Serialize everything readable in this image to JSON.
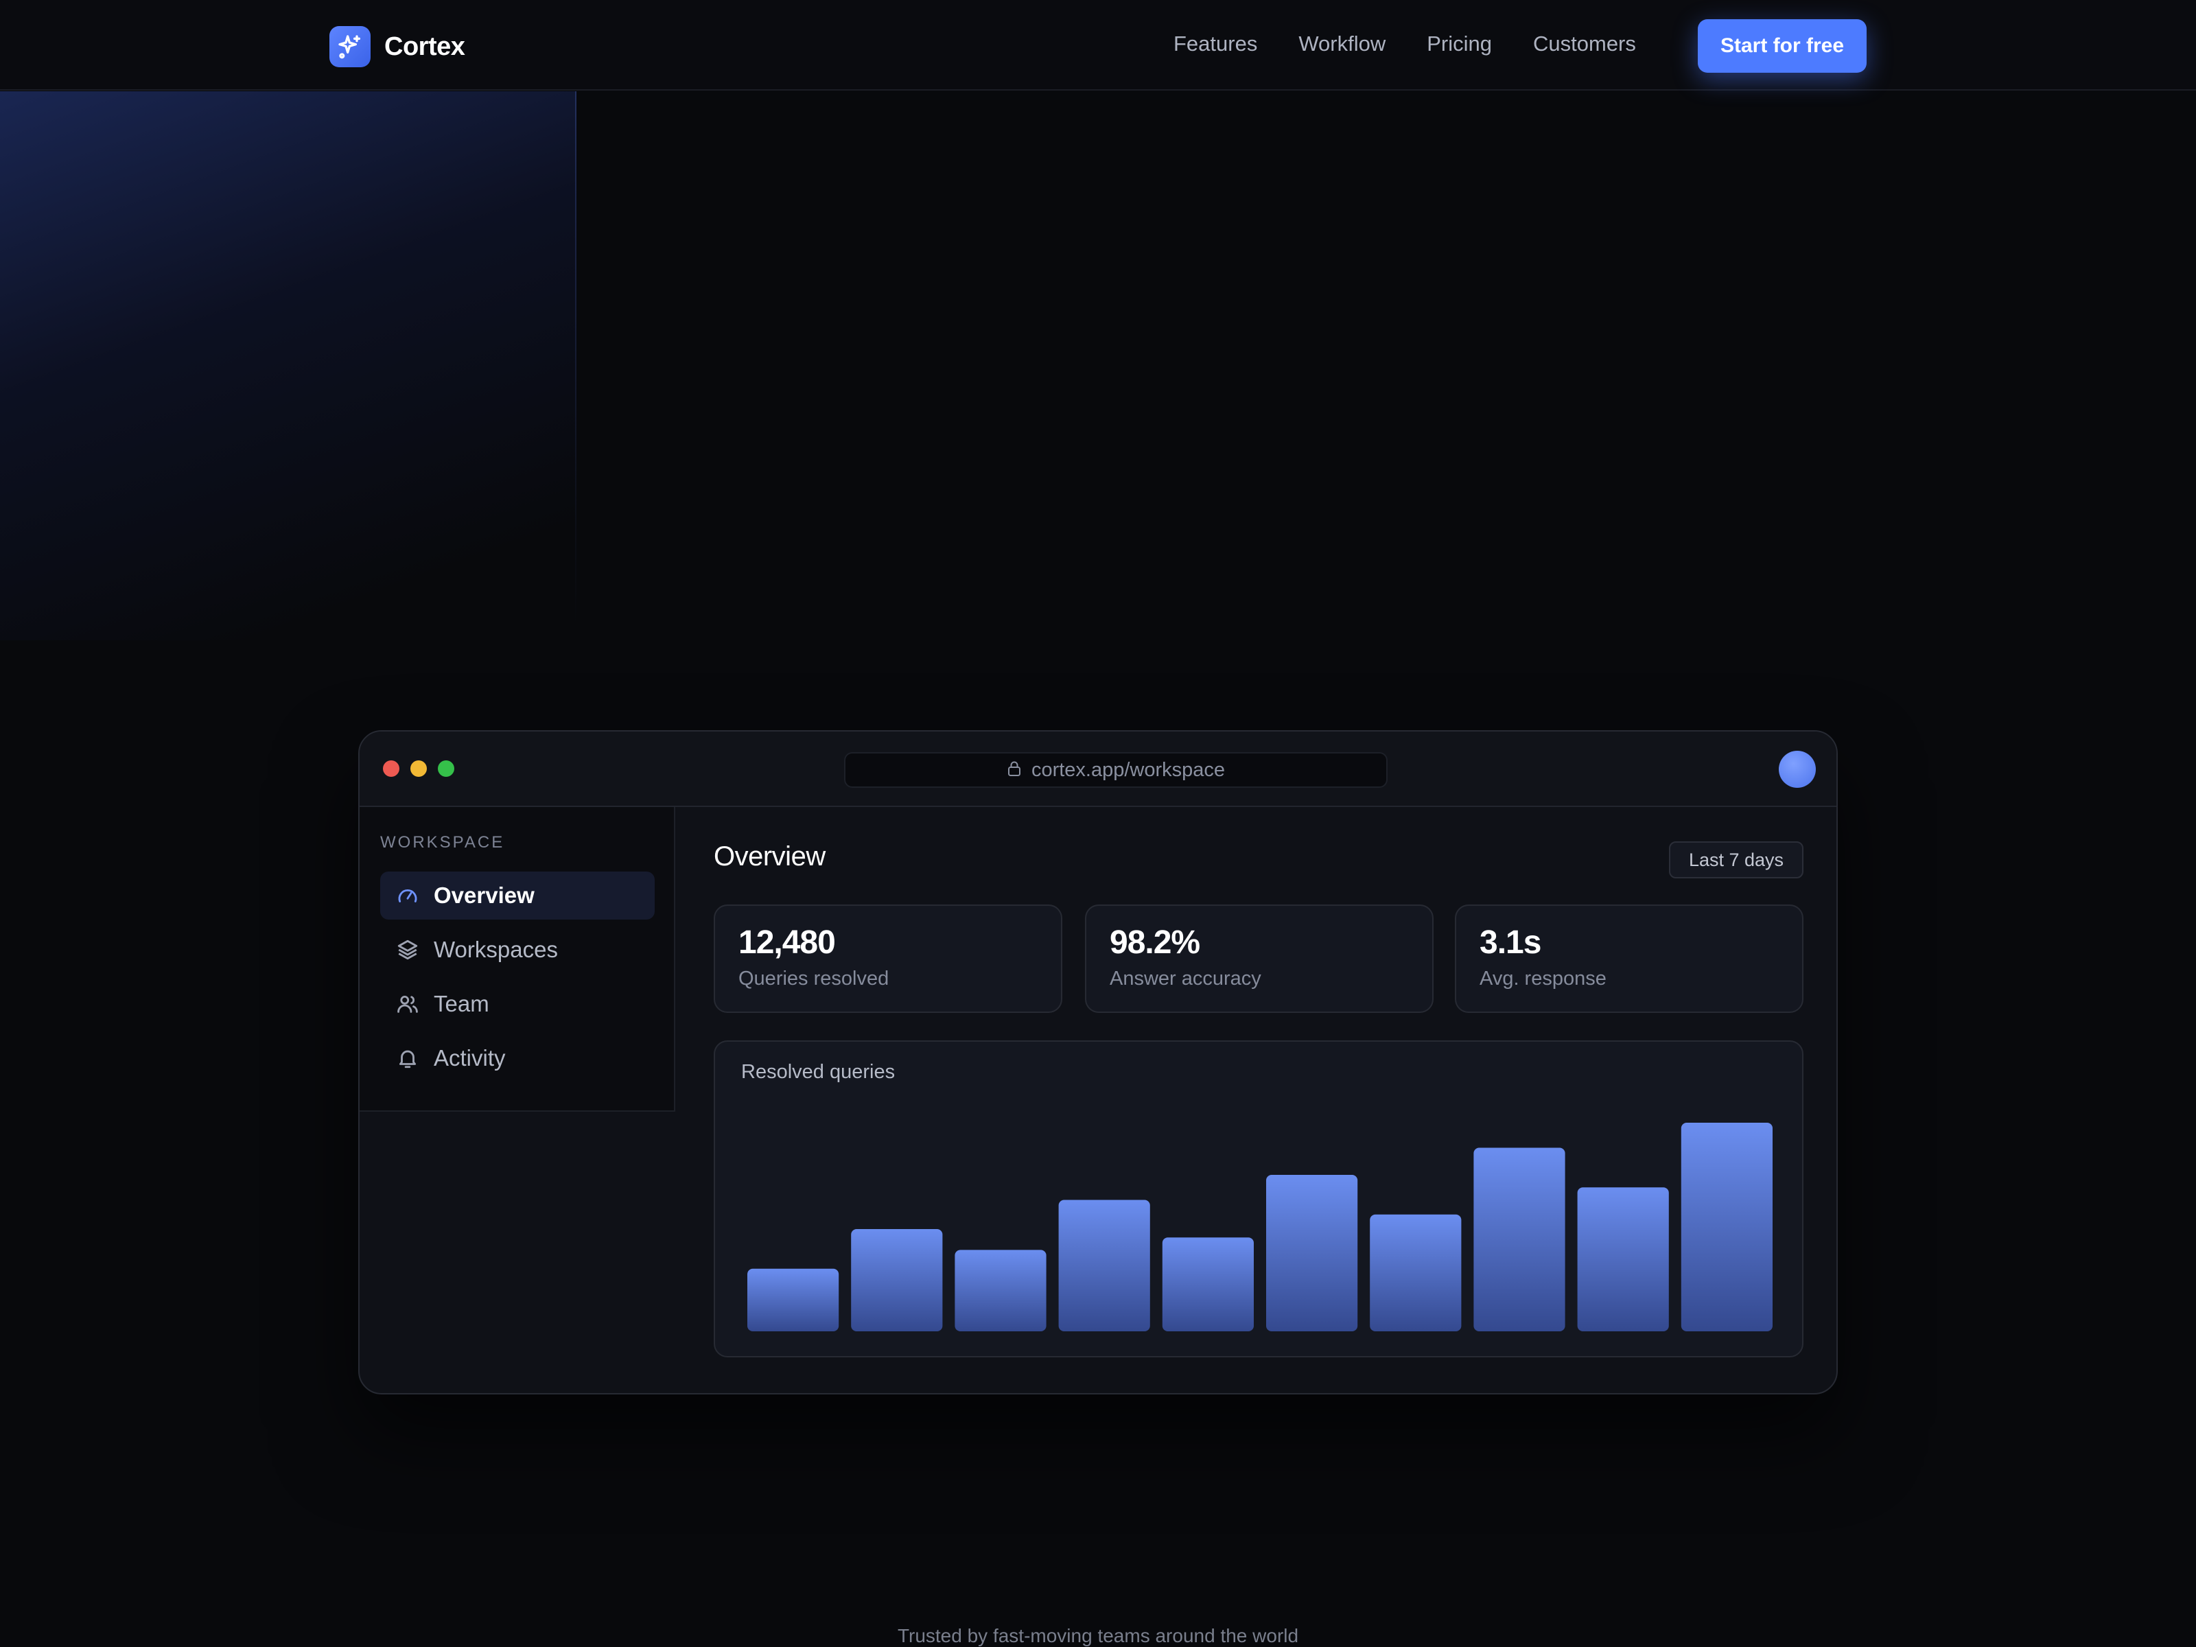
{
  "brand": {
    "name": "Cortex",
    "logo_icon": "sparkle-icon",
    "accent": "#4d7bff"
  },
  "nav": {
    "links": [
      "Features",
      "Workflow",
      "Pricing",
      "Customers"
    ],
    "cta_label": "Start for free"
  },
  "window": {
    "url": "cortex.app/workspace",
    "lock_icon": "lock-icon"
  },
  "sidebar": {
    "heading": "WORKSPACE",
    "items": [
      {
        "label": "Overview",
        "icon": "gauge-icon",
        "active": true
      },
      {
        "label": "Workspaces",
        "icon": "layers-icon",
        "active": false
      },
      {
        "label": "Team",
        "icon": "users-icon",
        "active": false
      },
      {
        "label": "Activity",
        "icon": "bell-icon",
        "active": false
      }
    ]
  },
  "main": {
    "title": "Overview",
    "range_label": "Last 7 days",
    "stats": [
      {
        "value": "12,480",
        "label": "Queries resolved"
      },
      {
        "value": "98.2%",
        "label": "Answer accuracy"
      },
      {
        "value": "3.1s",
        "label": "Avg. response"
      }
    ]
  },
  "chart_data": {
    "type": "bar",
    "title": "Resolved queries",
    "categories": [
      "",
      "",
      "",
      "",
      "",
      "",
      "",
      "",
      "",
      ""
    ],
    "values": [
      30,
      49,
      39,
      63,
      45,
      75,
      56,
      88,
      69,
      100
    ],
    "ylim": [
      0,
      100
    ],
    "grid": false,
    "xlabel": "",
    "ylabel": "",
    "bar_color_top": "#6b8ef0",
    "bar_color_bottom": "#34498f"
  },
  "footer": {
    "tagline": "Trusted by fast-moving teams around the world"
  }
}
